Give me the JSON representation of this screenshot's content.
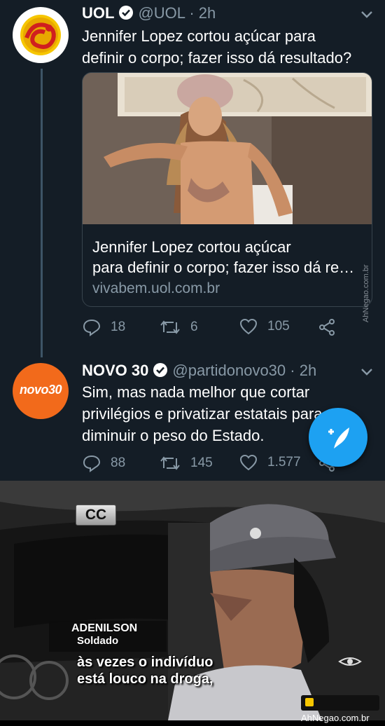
{
  "tweets": [
    {
      "name": "UOL",
      "handle": "@UOL · 2h",
      "text_lines": [
        "Jennifer Lopez cortou açúcar para",
        "definir o corpo; fazer isso dá resultado?"
      ],
      "card": {
        "title_lines": [
          "Jennifer Lopez cortou açúcar",
          "para definir o corpo; fazer isso dá re…"
        ],
        "domain": "vivabem.uol.com.br"
      },
      "actions": {
        "replies": "18",
        "retweets": "6",
        "likes": "105"
      }
    },
    {
      "name": "NOVO 30",
      "handle": "@partidonovo30 · 2h",
      "text_lines": [
        "Sim, mas nada melhor que cortar",
        "privilégios e privatizar estatais para",
        "diminuir o peso do Estado."
      ],
      "avatar_text": "novo30",
      "actions": {
        "replies": "88",
        "retweets": "145",
        "likes": "1.577"
      }
    }
  ],
  "watermark_side": "AhNegao.com.br",
  "meme": {
    "cc_badge": "CC",
    "name_line1": "ADENILSON",
    "name_line2": "Soldado",
    "subtitle_lines": [
      "às vezes o indivíduo",
      "está louco na droga,"
    ],
    "watermark": "AhNegao.com.br"
  },
  "colors": {
    "background": "#141d26",
    "text_secondary": "#8899a6",
    "accent": "#1da1f2",
    "novo_orange": "#f26a1b",
    "uol_yellow": "#f6c600"
  }
}
